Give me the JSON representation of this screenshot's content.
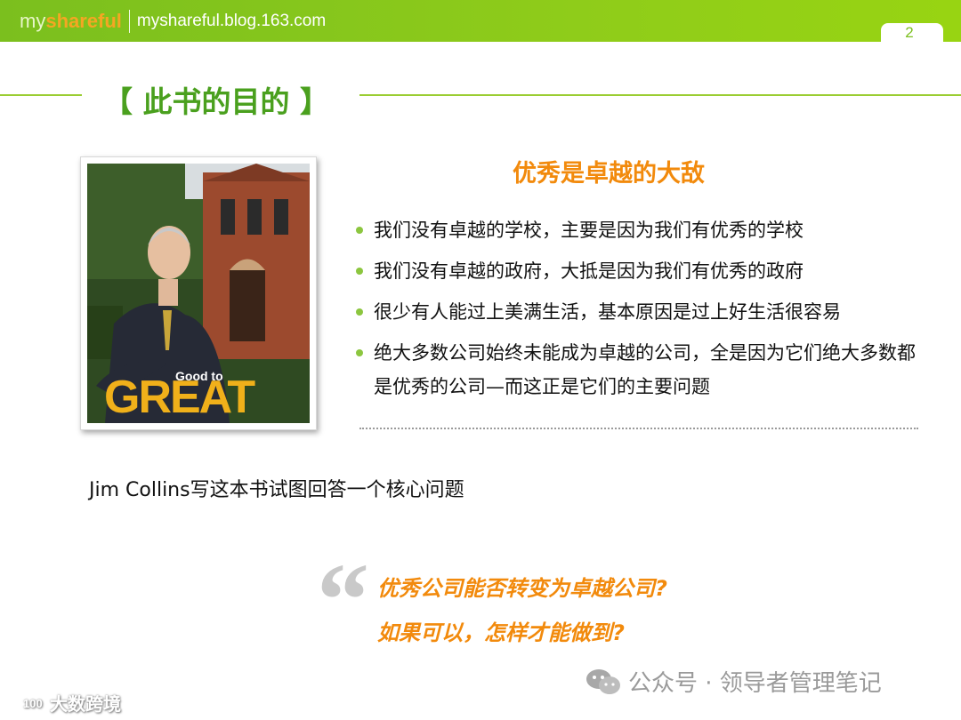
{
  "header": {
    "brand_my": "my",
    "brand_shareful": "shareful",
    "url": "myshareful.blog.163.com",
    "page_number": "2"
  },
  "section_title": "【 此书的目的 】",
  "book_cover": {
    "subtitle": "Good to",
    "title": "GREAT"
  },
  "content": {
    "heading": "优秀是卓越的大敌",
    "bullets": [
      "我们没有卓越的学校，主要是因为我们有优秀的学校",
      "我们没有卓越的政府，大抵是因为我们有优秀的政府",
      "很少有人能过上美满生活，基本原因是过上好生活很容易",
      "绝大多数公司始终未能成为卓越的公司，全是因为它们绝大多数都是优秀的公司—而这正是它们的主要问题"
    ]
  },
  "question_intro": "Jim Collins写这本书试图回答一个核心问题",
  "quote": {
    "mark": "“",
    "line1": "优秀公司能否转变为卓越公司?",
    "line2": "如果可以，怎样才能做到?"
  },
  "watermarks": {
    "right": "公众号 · 领导者管理笔记",
    "left": "大数跨境"
  },
  "colors": {
    "header_green": "#8fcc1a",
    "title_green": "#4aa01e",
    "accent_orange": "#f28a0c",
    "bullet_green": "#8cc63f"
  }
}
